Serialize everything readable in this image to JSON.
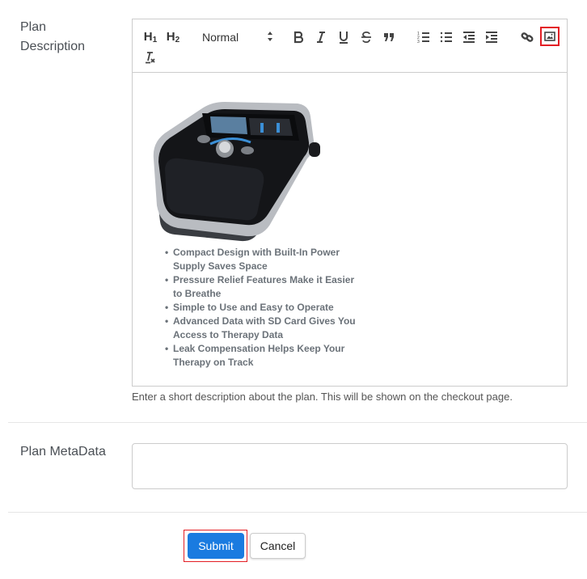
{
  "form": {
    "description_label": "Plan Description",
    "description_help": "Enter a short description about the plan. This will be shown on the checkout page.",
    "metadata_label": "Plan MetaData",
    "metadata_value": "",
    "submit_label": "Submit",
    "cancel_label": "Cancel"
  },
  "toolbar": {
    "h1_label": "H",
    "h1_sub": "1",
    "h2_label": "H",
    "h2_sub": "2",
    "format_selected": "Normal",
    "icons": [
      "header-1-icon",
      "header-2-icon",
      "format-select",
      "bold-icon",
      "italic-icon",
      "underline-icon",
      "strikethrough-icon",
      "blockquote-icon",
      "ordered-list-icon",
      "bullet-list-icon",
      "outdent-icon",
      "indent-icon",
      "link-icon",
      "image-icon",
      "clear-formatting-icon"
    ],
    "highlighted": "image-icon",
    "highlight_color": "#e31e24"
  },
  "editor": {
    "image_alt": "CPAP machine product image",
    "features": [
      "Compact Design with Built-In Power Supply Saves Space",
      "Pressure Relief Features Make it Easier to Breathe",
      "Simple to Use and Easy to Operate",
      "Advanced Data with SD Card Gives You Access to Therapy Data",
      "Leak Compensation Helps Keep Your Therapy on Track"
    ]
  },
  "colors": {
    "primary": "#1a7be0",
    "highlight": "#e31e24"
  }
}
